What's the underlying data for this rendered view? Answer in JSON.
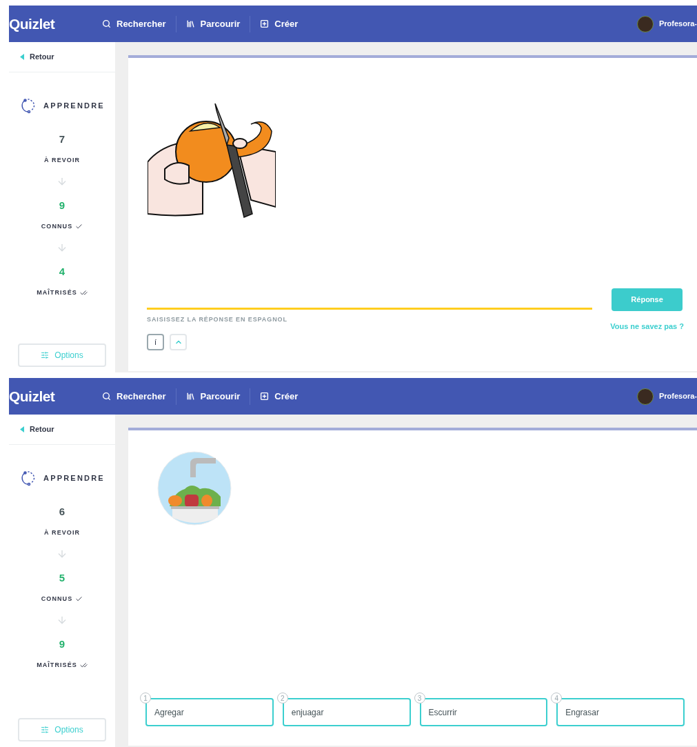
{
  "screens": [
    {
      "header": {
        "logo": "Quizlet",
        "nav": [
          {
            "label": "Rechercher"
          },
          {
            "label": "Parcourir"
          },
          {
            "label": "Créer"
          }
        ],
        "user": "Profesora-"
      },
      "sidebar": {
        "back": "Retour",
        "mode": "APPRENDRE",
        "stats": [
          {
            "kind": "review",
            "count": "7",
            "label": "À REVOIR"
          },
          {
            "kind": "known",
            "count": "9",
            "label": "CONNUS"
          },
          {
            "kind": "mastered",
            "count": "4",
            "label": "MAÎTRISÉS"
          }
        ],
        "options": "Options"
      },
      "question": {
        "kind": "written",
        "prompt": "SAISISSEZ LA RÉPONSE EN ESPAGNOL",
        "keys": [
          "í"
        ],
        "submit": "Réponse",
        "dont_know": "Vous ne savez pas ?"
      }
    },
    {
      "header": {
        "logo": "Quizlet",
        "nav": [
          {
            "label": "Rechercher"
          },
          {
            "label": "Parcourir"
          },
          {
            "label": "Créer"
          }
        ],
        "user": "Profesora-"
      },
      "sidebar": {
        "back": "Retour",
        "mode": "APPRENDRE",
        "stats": [
          {
            "kind": "review",
            "count": "6",
            "label": "À REVOIR"
          },
          {
            "kind": "known",
            "count": "5",
            "label": "CONNUS"
          },
          {
            "kind": "mastered",
            "count": "9",
            "label": "MAÎTRISÉS"
          }
        ],
        "options": "Options"
      },
      "question": {
        "kind": "multiple_choice",
        "choices": [
          {
            "number": "1",
            "label": "Agregar"
          },
          {
            "number": "2",
            "label": "enjuagar"
          },
          {
            "number": "3",
            "label": "Escurrir"
          },
          {
            "number": "4",
            "label": "Engrasar"
          }
        ]
      }
    }
  ]
}
